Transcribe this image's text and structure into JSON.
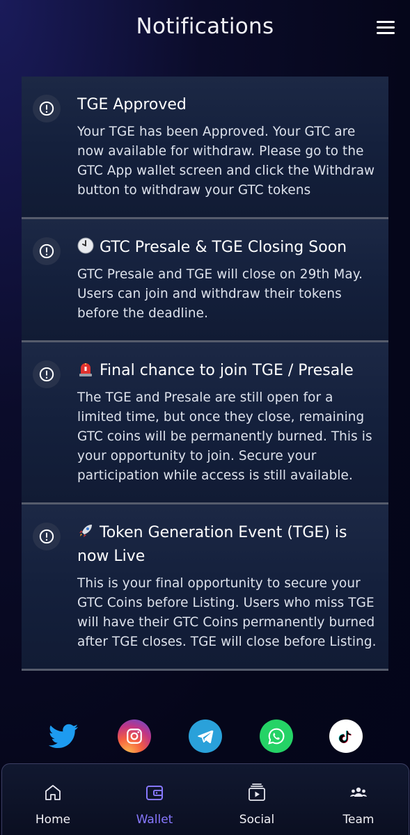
{
  "header": {
    "title": "Notifications",
    "menu_icon": "hamburger-menu-icon"
  },
  "notifications": [
    {
      "emoji": "",
      "title": "TGE Approved",
      "body": "Your TGE has been Approved. Your GTC are now available for withdraw. Please go to the GTC App wallet screen and click the Withdraw button to withdraw your GTC tokens"
    },
    {
      "emoji": "clock-emoji",
      "title": "GTC Presale & TGE Closing Soon",
      "body": "GTC Presale and TGE will close on 29th May. Users can join and withdraw their tokens before the deadline."
    },
    {
      "emoji": "siren-emoji",
      "title": "Final chance to join TGE / Presale",
      "body": "The TGE and Presale are still open for a limited time, but once they close, remaining GTC coins will be permanently burned. This is your opportunity to join. Secure your participation while access is still available."
    },
    {
      "emoji": "rocket-emoji",
      "title": "Token Generation Event (TGE) is now Live",
      "body": "This is your final opportunity to secure your GTC Coins before Listing. Users who miss TGE will have their GTC Coins permanently burned after TGE closes. TGE will close before Listing."
    }
  ],
  "social": [
    {
      "name": "twitter",
      "color": "#1d9bf0"
    },
    {
      "name": "instagram",
      "color": "#e1306c"
    },
    {
      "name": "telegram",
      "color": "#2aa1da"
    },
    {
      "name": "whatsapp",
      "color": "#25d366"
    },
    {
      "name": "tiktok",
      "color": "#ffffff"
    }
  ],
  "nav": {
    "home": "Home",
    "wallet": "Wallet",
    "social": "Social",
    "team": "Team",
    "active": "wallet",
    "active_color": "#8778ff"
  }
}
